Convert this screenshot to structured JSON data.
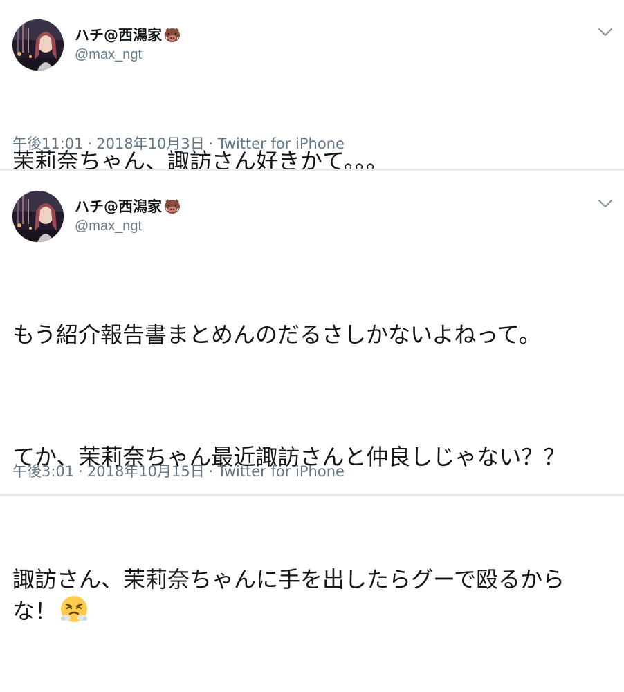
{
  "tweets": [
    {
      "display_name": "ハチ@西潟家",
      "handle": "@max_ngt",
      "text_paragraphs": [
        "茉莉奈ちゃん、諏訪さん好きかて。。。"
      ],
      "time": "午後11:01",
      "date": "2018年10月3日",
      "source": "Twitter for iPhone"
    },
    {
      "display_name": "ハチ@西潟家",
      "handle": "@max_ngt",
      "text_paragraphs": [
        "もう紹介報告書まとめんのだるさしかないよねって。",
        "てか、茉莉奈ちゃん最近諏訪さんと仲良しじゃない？？",
        "諏訪さん、茉莉奈ちゃんに手を出したらグーで殴るから\nな！"
      ],
      "time": "午後3:01",
      "date": "2018年10月15日",
      "source": "Twitter for iPhone"
    }
  ],
  "separator": "·",
  "icons": {
    "name_emoji": "boar-face-icon",
    "menu": "chevron-down-icon",
    "text_emoji": "face-with-steam-icon"
  },
  "colors": {
    "text": "#14171a",
    "secondary": "#657786",
    "divider": "#e6ecf0"
  }
}
